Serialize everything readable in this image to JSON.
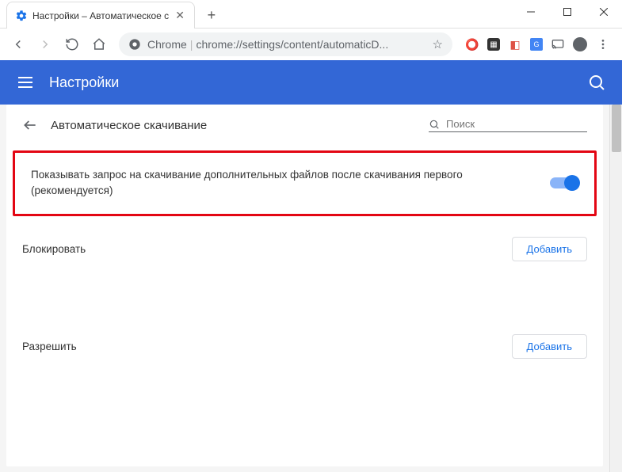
{
  "window": {
    "tab_title": "Настройки – Автоматическое с",
    "controls": {
      "min": "—",
      "max": "☐",
      "close": "✕"
    }
  },
  "toolbar": {
    "omnibox_label": "Chrome",
    "omnibox_url": "chrome://settings/content/automaticD..."
  },
  "header": {
    "title": "Настройки"
  },
  "page": {
    "subtitle": "Автоматическое скачивание",
    "search_placeholder": "Поиск"
  },
  "setting": {
    "main_toggle_label": "Показывать запрос на скачивание дополнительных файлов после скачивания первого (рекомендуется)"
  },
  "sections": {
    "block": {
      "label": "Блокировать",
      "add": "Добавить"
    },
    "allow": {
      "label": "Разрешить",
      "add": "Добавить"
    }
  }
}
